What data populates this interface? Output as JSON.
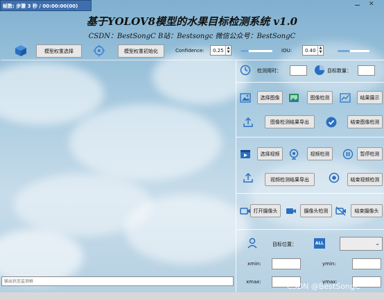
{
  "overlay": {
    "status_text": "帧数: 步骤 3 秒 / 00:00:00(00)"
  },
  "header": {
    "title": "基于YOLOV8模型的水果目标检测系统 v1.0",
    "subtitle": "CSDN：BestSongC   B站：Bestsongc   微信公众号：BestSongC"
  },
  "toolbar": {
    "model_select_label": "模型权重选择",
    "model_init_label": "模型权重初始化",
    "confidence_label": "Confidence:",
    "confidence_value": "0.25",
    "confidence_level": 0.25,
    "iou_label": "IOU:",
    "iou_value": "0.40",
    "iou_level": 0.4
  },
  "stats": {
    "time_label": "检测用时：",
    "count_label": "目标数量："
  },
  "image_section": {
    "select_label": "选择图像",
    "detect_label": "图像检测",
    "show_label": "结果展示",
    "export_label": "图像检测结果导出",
    "stop_label": "结束图像检测"
  },
  "video_section": {
    "select_label": "选择视频",
    "detect_label": "视频检测",
    "pause_label": "暂停检测",
    "export_label": "视频检测结果导出",
    "stop_label": "结束视频检测"
  },
  "camera_section": {
    "open_label": "打开摄像头",
    "detect_label": "摄像头检测",
    "stop_label": "结束摄像头"
  },
  "target_section": {
    "position_label": "目标位置：",
    "all_badge": "ALL",
    "xmin_label": "xmin:",
    "ymin_label": "ymin:",
    "xmax_label": "xmax:",
    "ymax_label": "ymax:"
  },
  "status_bar": {
    "placeholder": "输出状态监测框"
  },
  "watermark": "CSDN @BestSongC"
}
